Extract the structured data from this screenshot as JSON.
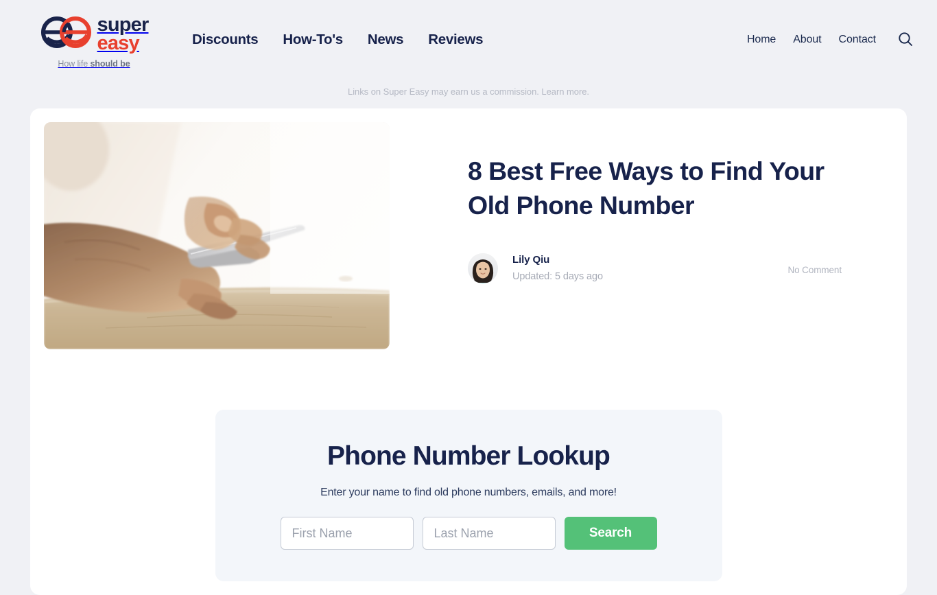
{
  "brand": {
    "name_line1": "super",
    "name_line2": "easy",
    "tagline_prefix": "How life ",
    "tagline_bold": "should be",
    "logo_icon": "super-easy-double-e-logo",
    "colors": {
      "navy": "#19234a",
      "red": "#e8402e"
    }
  },
  "nav": {
    "primary": [
      {
        "label": "Discounts"
      },
      {
        "label": "How-To's"
      },
      {
        "label": "News"
      },
      {
        "label": "Reviews"
      }
    ],
    "secondary": [
      {
        "label": "Home"
      },
      {
        "label": "About"
      },
      {
        "label": "Contact"
      }
    ],
    "search_icon": "search-icon"
  },
  "disclaimer": {
    "text": "Links on Super Easy may earn us a commission. ",
    "link": "Learn more."
  },
  "article": {
    "title": "8 Best Free Ways to Find Your Old Phone Number",
    "hero_alt": "hands-holding-smartphone-on-wooden-table",
    "author": {
      "name": "Lily Qiu",
      "avatar_alt": "author-portrait"
    },
    "updated": "Updated: 5 days ago",
    "comments": "No Comment"
  },
  "lookup": {
    "title": "Phone Number Lookup",
    "subtitle": "Enter your name to find old phone numbers, emails, and more!",
    "first_name_placeholder": "First Name",
    "first_name_value": "",
    "last_name_placeholder": "Last Name",
    "last_name_value": "",
    "search_label": "Search",
    "accent_color": "#54c178"
  }
}
